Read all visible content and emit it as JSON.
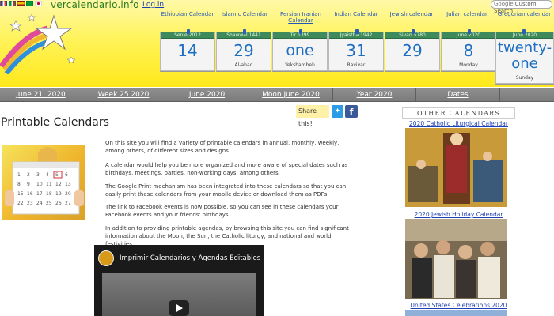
{
  "header": {
    "logo": "vercalendario.info",
    "login": "Log in",
    "search_placeholder": "Custom Search",
    "search_brand": "Google"
  },
  "calendars": [
    {
      "label": "Ethiopian Calendar",
      "date_header": "Senie 2012",
      "value": "14",
      "sub": ""
    },
    {
      "label": "Islamic Calendar",
      "date_header": "Shawwal 1441",
      "value": "29",
      "sub": "Al-ahad"
    },
    {
      "label": "Persian Iranian Calendar",
      "date_header": "Tir 1399",
      "value": "one",
      "sub": "Yekshambeh"
    },
    {
      "label": "Indian Calendar",
      "date_header": "Jyaistha 1942",
      "value": "31",
      "sub": "Ravivar"
    },
    {
      "label": "Jewish calendar",
      "date_header": "Sivan 5780",
      "value": "29",
      "sub": ""
    },
    {
      "label": "Julian calendar",
      "date_header": "June 2020",
      "value": "8",
      "sub": "Monday"
    },
    {
      "label": "Gregorian calendar",
      "date_header": "June 2020",
      "value": "twenty-one",
      "sub": "Sunday"
    }
  ],
  "nav": [
    {
      "label": "June 21, 2020"
    },
    {
      "label": "Week 25 2020"
    },
    {
      "label": "June 2020"
    },
    {
      "label": "Moon June 2020"
    },
    {
      "label": "Year 2020"
    },
    {
      "label": "Dates"
    }
  ],
  "share": {
    "label": "Share this!",
    "twitter_icon": "twitter-icon",
    "facebook_icon": "facebook-icon"
  },
  "main": {
    "title": "Printable Calendars",
    "paragraphs": [
      "On this site you will find a variety of printable calendars in annual, monthly, weekly, among others, of different sizes and designs.",
      "A calendar would help you be more organized and more aware of special dates such as birthdays, meetings, parties, non-working days, among others.",
      "The Google Print mechanism has been integrated into these calendars so that you can easily print these calendars from your mobile device or download them as PDFs.",
      "The link to Facebook events is now possible, so you can see in these calendars your Facebook events and your friends' birthdays.",
      "In addition to providing printable agendas, by browsing this site you can find significant information about the Moon, the Sun, the Catholic liturgy, and national and world festivities."
    ],
    "video_title": "Imprimir Calendarios y Agendas Editables"
  },
  "sidebar": {
    "title": "OTHER CALENDARS",
    "links": [
      "2020 Catholic Liturgical Calendar",
      "2020 Jewish Holiday Calendar",
      "United States Celebrations 2020"
    ]
  },
  "colors": {
    "header_yellow": "#ffe81a",
    "link_blue": "#1f3fb5",
    "card_header_green": "#3e8a5a",
    "nav_gray": "#7b7b7b"
  }
}
